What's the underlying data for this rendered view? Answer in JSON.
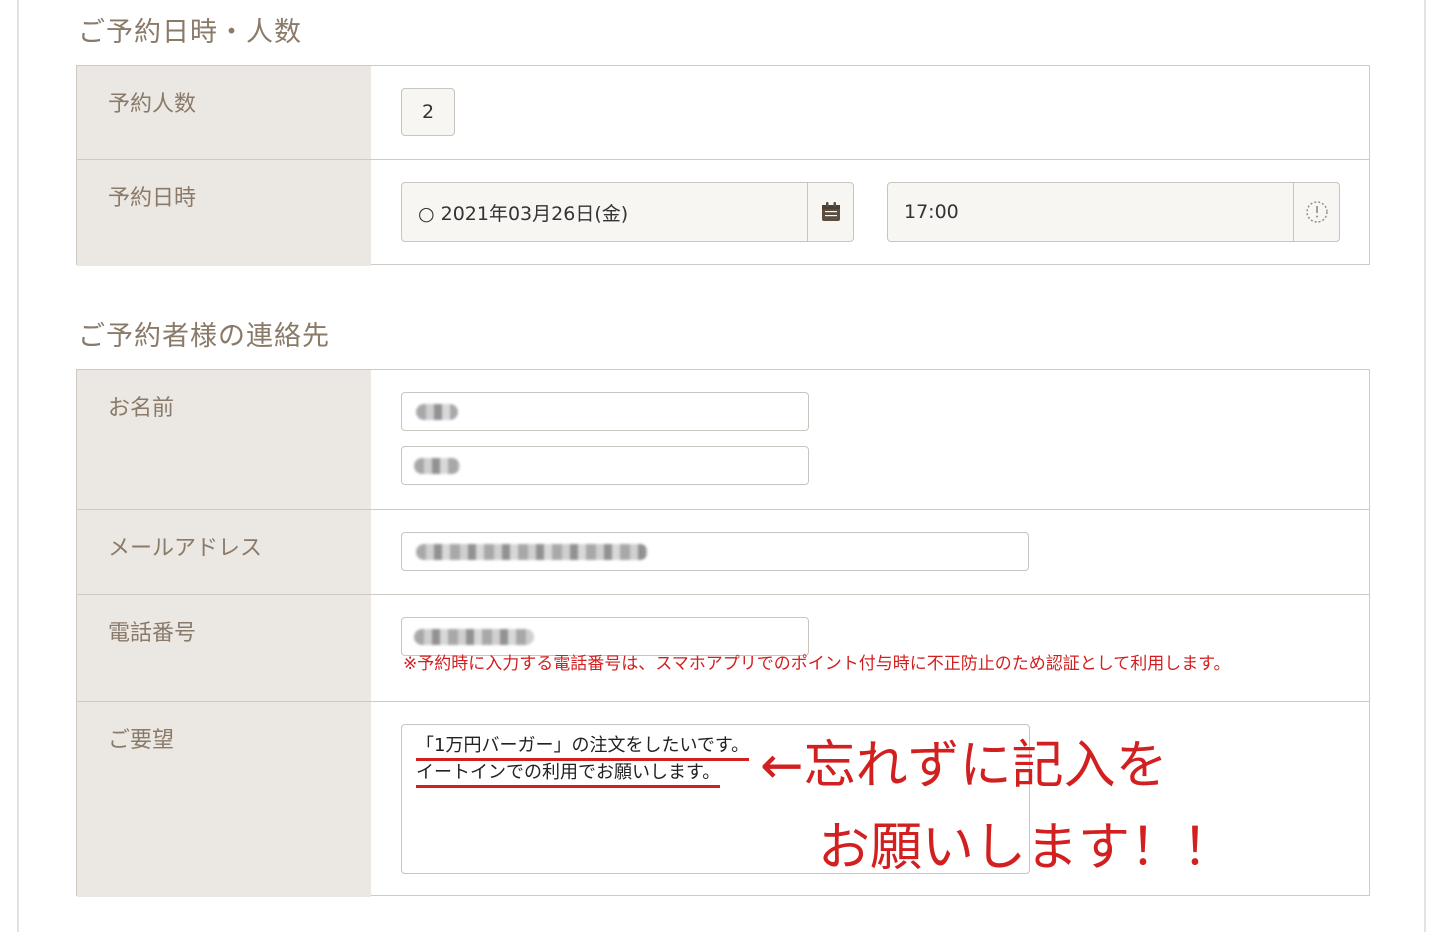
{
  "sections": {
    "reservation_datetime": {
      "title": "ご予約日時・人数"
    },
    "contact": {
      "title": "ご予約者様の連絡先"
    }
  },
  "reservation": {
    "people_label": "予約人数",
    "people_value": "2",
    "datetime_label": "予約日時",
    "date_value": "○ 2021年03月26日(金)",
    "date_icon": "calendar-icon",
    "time_value": "17:00",
    "time_icon": "clock-icon"
  },
  "contact": {
    "name_label": "お名前",
    "email_label": "メールアドレス",
    "phone_label": "電話番号",
    "phone_note": "※予約時に入力する電話番号は、スマホアプリでのポイント付与時に不正防止のため認証として利用します。",
    "request_label": "ご要望",
    "request_lines": [
      "「1万円バーガー」の注文をしたいです。",
      "イートインでの利用でお願いします。"
    ]
  },
  "annotation": {
    "line1": "←忘れずに記入を",
    "line2": "お願いします！！"
  },
  "colors": {
    "label_bg": "#ebe8e3",
    "label_text": "#8a7a69",
    "border": "#cfcac3",
    "accent_red": "#d21f1f"
  }
}
